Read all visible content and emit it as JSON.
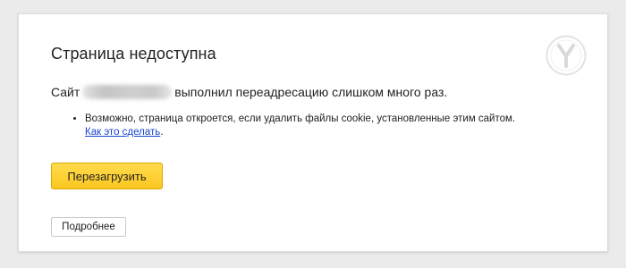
{
  "page": {
    "title": "Страница недоступна"
  },
  "message": {
    "prefix": "Сайт",
    "url_hidden": true,
    "suffix": "выполнил переадресацию слишком много раз."
  },
  "tips": {
    "item_text": "Возможно, страница откроется, если удалить файлы cookie, установленные этим сайтом.",
    "link_text": "Как это сделать",
    "link_suffix": "."
  },
  "buttons": {
    "reload_label": "Перезагрузить",
    "details_label": "Подробнее"
  },
  "logo": {
    "icon": "yandex-browser-logo-icon",
    "letter": "Y"
  },
  "colors": {
    "accent_button": "#fbc720",
    "link": "#1a44cc",
    "background": "#ebebeb",
    "card": "#ffffff"
  }
}
